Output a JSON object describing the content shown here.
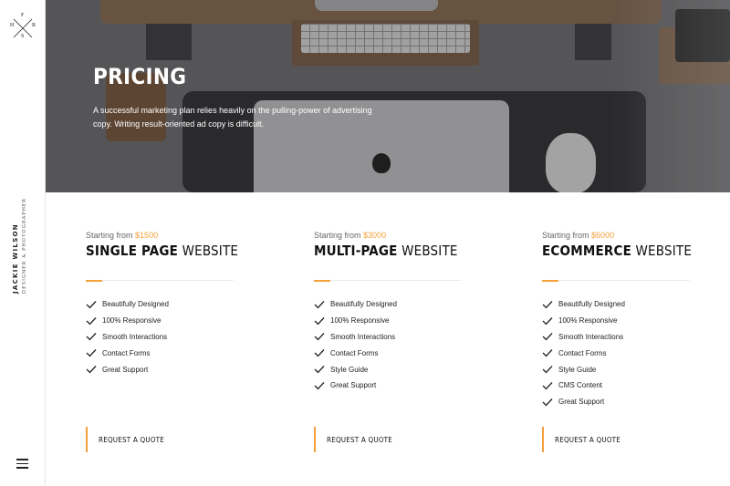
{
  "logo": {
    "letters": [
      "H",
      "F",
      "R",
      "S"
    ]
  },
  "sidebar": {
    "name": "JACKIE WILSON",
    "role": "DESIGNER & PHOTOGRAPHER",
    "menu_icon": "hamburger-icon"
  },
  "hero": {
    "title": "PRICING",
    "description": "A successful marketing plan relies heavily on the pulling-power of advertising copy. Writing result-oriented ad copy is difficult."
  },
  "colors": {
    "accent": "#f5a03a"
  },
  "plans": [
    {
      "starting_label": "Starting from",
      "price": "$1500",
      "title_bold": "SINGLE PAGE",
      "title_rest": " WEBSITE",
      "features": [
        "Beautifully Designed",
        "100% Responsive",
        "Smooth Interactions",
        "Contact Forms",
        "Great Support"
      ],
      "cta": "REQUEST A QUOTE"
    },
    {
      "starting_label": "Starting from",
      "price": "$3000",
      "title_bold": "MULTI-PAGE",
      "title_rest": " WEBSITE",
      "features": [
        "Beautifully Designed",
        "100% Responsive",
        "Smooth Interactions",
        "Contact Forms",
        "Style Guide",
        "Great Support"
      ],
      "cta": "REQUEST A QUOTE"
    },
    {
      "starting_label": "Starting from",
      "price": "$6000",
      "title_bold": "ECOMMERCE",
      "title_rest": " WEBSITE",
      "features": [
        "Beautifully Designed",
        "100% Responsive",
        "Smooth Interactions",
        "Contact Forms",
        "Style Guide",
        "CMS Content",
        "Great Support"
      ],
      "cta": "REQUEST A QUOTE"
    }
  ]
}
